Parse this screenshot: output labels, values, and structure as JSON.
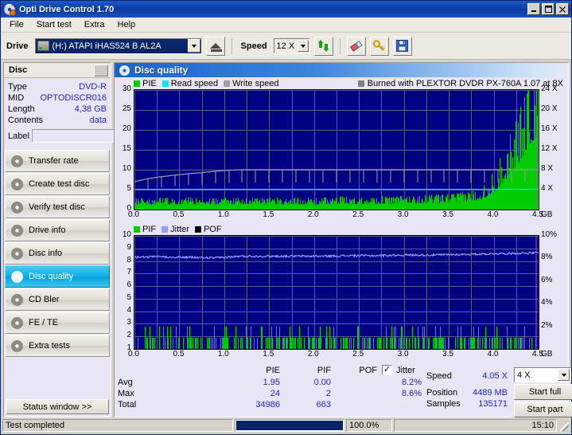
{
  "window": {
    "title": "Opti Drive Control 1.70",
    "icon": "disc-icon",
    "minimize": "_",
    "maximize": "□",
    "close": "✕"
  },
  "menu": [
    {
      "label": "File"
    },
    {
      "label": "Start test"
    },
    {
      "label": "Extra"
    },
    {
      "label": "Help"
    }
  ],
  "toolbar": {
    "drive_label": "Drive",
    "drive_value": "(H:)   ATAPI iHAS524   B AL2A",
    "eject_icon": "eject-icon",
    "speed_label": "Speed",
    "speed_value": "12 X",
    "refresh_icon": "refresh-icon",
    "eraser_icon": "eraser-icon",
    "key_icon": "key-icon",
    "save_icon": "save-icon"
  },
  "disc": {
    "header": "Disc",
    "rows": [
      {
        "key": "Type",
        "value": "DVD-R"
      },
      {
        "key": "MID",
        "value": "OPTODISCR016"
      },
      {
        "key": "Length",
        "value": "4,38 GB"
      },
      {
        "key": "Contents",
        "value": "data"
      }
    ],
    "label_key": "Label",
    "label_value": "",
    "label_placeholder": ""
  },
  "nav": {
    "items": [
      {
        "label": "Transfer rate",
        "active": false
      },
      {
        "label": "Create test disc",
        "active": false
      },
      {
        "label": "Verify test disc",
        "active": false
      },
      {
        "label": "Drive info",
        "active": false
      },
      {
        "label": "Disc info",
        "active": false
      },
      {
        "label": "Disc quality",
        "active": true
      },
      {
        "label": "CD Bler",
        "active": false
      },
      {
        "label": "FE / TE",
        "active": false
      },
      {
        "label": "Extra tests",
        "active": false
      }
    ],
    "status_window": "Status window >>"
  },
  "panel": {
    "title": "Disc quality",
    "burned_with": "Burned with PLEXTOR DVDR   PX-760A 1.07 at 8X",
    "burned_swatch": "#808080"
  },
  "chart_data": [
    {
      "type": "line",
      "title": "PIE / Read speed / Write speed",
      "legend": [
        {
          "label": "PIE",
          "color": "#00cc00"
        },
        {
          "label": "Read speed",
          "color": "#00e5ff"
        },
        {
          "label": "Write speed",
          "color": "#a0a0a0"
        }
      ],
      "legend_position": "top-left",
      "grid": true,
      "xlabel": "GB",
      "x_unit": "GB",
      "xlim": [
        0.0,
        4.5
      ],
      "xticks": [
        "0.0",
        "0.5",
        "1.0",
        "1.5",
        "2.0",
        "2.5",
        "3.0",
        "3.5",
        "4.0",
        "4.5"
      ],
      "ylabel": "PIE",
      "ylim": [
        0,
        30
      ],
      "yticks": [
        "30",
        "25",
        "20",
        "15",
        "10",
        "5",
        "0"
      ],
      "y2label": "Speed",
      "y2lim": [
        0,
        24
      ],
      "y2ticks": [
        "24 X",
        "20 X",
        "16 X",
        "12 X",
        "8 X",
        "4 X"
      ],
      "series": [
        {
          "name": "PIE",
          "color": "#00cc00",
          "style": "bars",
          "x": [
            0.0,
            0.1,
            0.2,
            0.3,
            0.4,
            0.5,
            0.6,
            0.7,
            0.8,
            0.9,
            1.0,
            1.1,
            1.2,
            1.3,
            1.4,
            1.5,
            1.6,
            1.7,
            1.8,
            1.9,
            2.0,
            2.1,
            2.2,
            2.3,
            2.4,
            2.5,
            2.6,
            2.7,
            2.8,
            2.9,
            3.0,
            3.1,
            3.2,
            3.3,
            3.4,
            3.5,
            3.6,
            3.7,
            3.8,
            3.9,
            4.0,
            4.1,
            4.2,
            4.3,
            4.4,
            4.5
          ],
          "values": [
            1.6,
            1.7,
            1.5,
            1.8,
            1.6,
            1.7,
            1.9,
            1.6,
            1.5,
            1.7,
            1.8,
            1.6,
            1.7,
            1.9,
            1.6,
            1.8,
            1.7,
            1.6,
            1.8,
            1.7,
            1.6,
            1.8,
            1.7,
            1.9,
            1.8,
            1.7,
            1.9,
            1.8,
            2.0,
            1.9,
            2.0,
            2.1,
            2.0,
            2.2,
            2.1,
            2.3,
            2.4,
            2.6,
            3.0,
            3.8,
            5.5,
            8.5,
            12.0,
            16.0,
            21.0,
            24.0
          ]
        },
        {
          "name": "Read speed",
          "color": "#00e5ff",
          "style": "line",
          "values_x_axis": "y2",
          "x": [
            0.0,
            4.5
          ],
          "values": [
            4.05,
            4.05
          ]
        },
        {
          "name": "Write speed",
          "color": "#a0a0a0",
          "style": "step-line",
          "values_x_axis": "y2",
          "x": [
            0.0,
            0.15,
            0.3,
            0.45,
            0.6,
            0.75,
            0.9,
            1.05,
            1.2,
            1.35,
            1.5,
            1.65,
            1.8,
            2.0,
            2.2,
            2.4,
            2.6,
            2.8,
            3.0,
            3.2,
            3.4,
            3.6,
            3.8,
            4.0,
            4.2,
            4.4,
            4.5
          ],
          "values": [
            5.6,
            6.2,
            6.6,
            6.9,
            7.2,
            7.4,
            7.7,
            7.9,
            8.0,
            8.0,
            8.0,
            8.0,
            8.0,
            8.0,
            8.0,
            8.0,
            8.0,
            8.0,
            8.0,
            8.0,
            8.0,
            8.0,
            8.0,
            8.0,
            8.0,
            8.0,
            8.0
          ]
        }
      ],
      "stats_note": "PIE avg 1.95, max 24, total 34986"
    },
    {
      "type": "line",
      "title": "PIF / Jitter / POF",
      "legend": [
        {
          "label": "PIF",
          "color": "#00cc00"
        },
        {
          "label": "Jitter",
          "color": "#9a9aff"
        },
        {
          "label": "POF",
          "color": "#000000"
        }
      ],
      "legend_position": "top-left",
      "grid": true,
      "xlabel": "GB",
      "xlim": [
        0.0,
        4.5
      ],
      "xticks": [
        "0.0",
        "0.5",
        "1.0",
        "1.5",
        "2.0",
        "2.5",
        "3.0",
        "3.5",
        "4.0",
        "4.5"
      ],
      "ylabel": "PIF",
      "ylim": [
        0,
        10
      ],
      "yticks": [
        "10",
        "9",
        "8",
        "7",
        "6",
        "5",
        "4",
        "3",
        "2",
        "1"
      ],
      "y2label": "Jitter",
      "y2lim": [
        0,
        10
      ],
      "y2ticks": [
        "10%",
        "8%",
        "6%",
        "4%",
        "2%"
      ],
      "series": [
        {
          "name": "PIF",
          "color": "#00cc00",
          "style": "bars",
          "x": [
            0.0,
            0.1,
            0.2,
            0.3,
            0.4,
            0.5,
            0.6,
            0.7,
            0.8,
            0.9,
            1.0,
            1.1,
            1.2,
            1.3,
            1.4,
            1.5,
            1.6,
            1.7,
            1.8,
            1.9,
            2.0,
            2.1,
            2.2,
            2.3,
            2.4,
            2.5,
            2.6,
            2.7,
            2.8,
            2.9,
            3.0,
            3.1,
            3.2,
            3.3,
            3.4,
            3.5,
            3.6,
            3.7,
            3.8,
            3.9,
            4.0,
            4.1,
            4.2,
            4.3,
            4.4,
            4.5
          ],
          "values": [
            1,
            1,
            2,
            1,
            1,
            2,
            1,
            1,
            1,
            2,
            1,
            1,
            1,
            1,
            2,
            1,
            1,
            1,
            2,
            1,
            1,
            1,
            1,
            2,
            1,
            1,
            1,
            1,
            1,
            1,
            1,
            1,
            1,
            2,
            1,
            1,
            1,
            1,
            1,
            1,
            1,
            1,
            1,
            1,
            1,
            1
          ]
        },
        {
          "name": "Jitter",
          "color": "#9a9aff",
          "style": "line",
          "values_x_axis": "y2",
          "x": [
            0.0,
            0.3,
            0.6,
            0.9,
            1.2,
            1.5,
            1.8,
            2.1,
            2.4,
            2.7,
            3.0,
            3.3,
            3.6,
            3.9,
            4.2,
            4.5
          ],
          "values": [
            8.1,
            8.15,
            8.1,
            8.05,
            8.2,
            8.2,
            8.2,
            8.2,
            8.25,
            8.25,
            8.3,
            8.3,
            8.35,
            8.4,
            8.45,
            8.5
          ]
        }
      ],
      "stats_note": "PIF avg 0.00, max 2, total 663; Jitter avg 8.2%, max 8.6%"
    }
  ],
  "stats": {
    "col_headers": [
      "PIE",
      "PIF",
      "POF"
    ],
    "jitter_label": "Jitter",
    "jitter_checked": true,
    "jitter_check_glyph": "✓",
    "rows": [
      {
        "label": "Avg",
        "pie": "1.95",
        "pif": "0.00",
        "pof": "",
        "jitter": "8.2%"
      },
      {
        "label": "Max",
        "pie": "24",
        "pif": "2",
        "pof": "",
        "jitter": "8.6%"
      },
      {
        "label": "Total",
        "pie": "34986",
        "pif": "663",
        "pof": "",
        "jitter": ""
      }
    ],
    "speed_label": "Speed",
    "speed_value": "4.05 X",
    "position_label": "Position",
    "position_value": "4489 MB",
    "samples_label": "Samples",
    "samples_value": "135171",
    "speed_select": "4 X",
    "start_full": "Start full",
    "start_part": "Start part"
  },
  "statusbar": {
    "message": "Test completed",
    "progress_pct": "100.0%",
    "progress_value": 100,
    "elapsed": "15:10"
  }
}
